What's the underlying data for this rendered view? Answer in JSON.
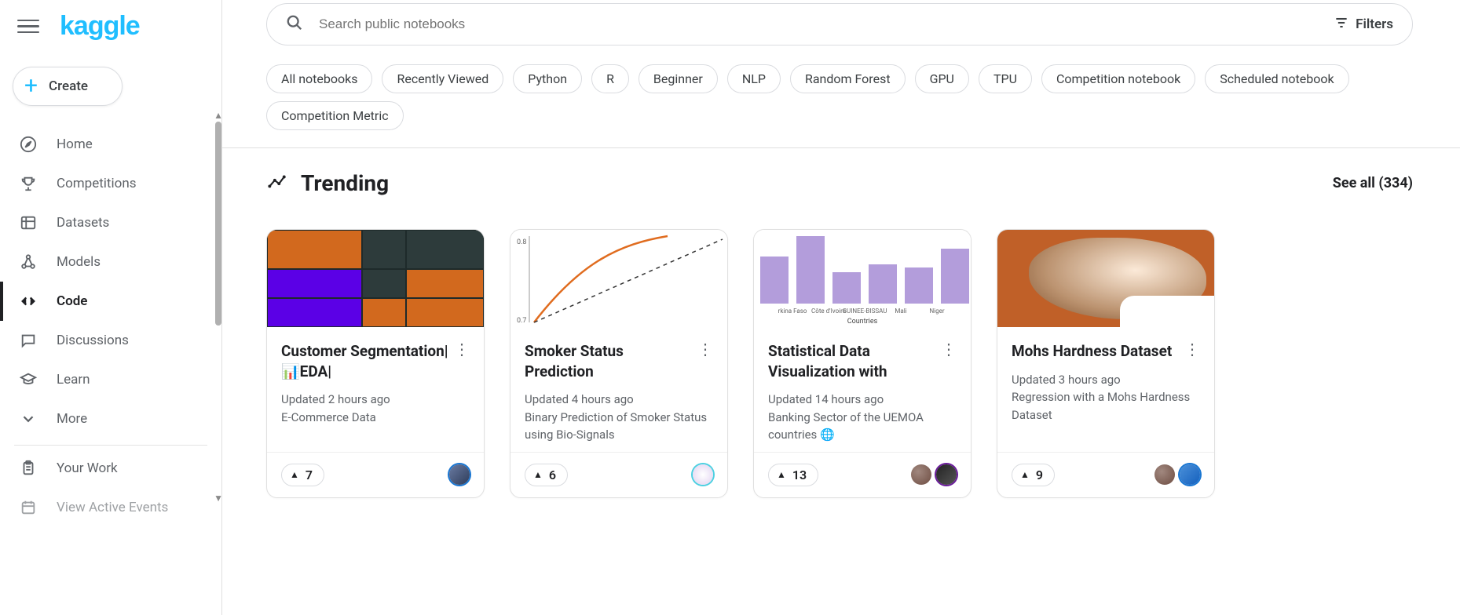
{
  "logo": "kaggle",
  "create_label": "Create",
  "nav": [
    {
      "key": "home",
      "label": "Home"
    },
    {
      "key": "competitions",
      "label": "Competitions"
    },
    {
      "key": "datasets",
      "label": "Datasets"
    },
    {
      "key": "models",
      "label": "Models"
    },
    {
      "key": "code",
      "label": "Code",
      "active": true
    },
    {
      "key": "discussions",
      "label": "Discussions"
    },
    {
      "key": "learn",
      "label": "Learn"
    },
    {
      "key": "more",
      "label": "More"
    }
  ],
  "nav_secondary": [
    {
      "key": "your-work",
      "label": "Your Work"
    },
    {
      "key": "view-active-events",
      "label": "View Active Events"
    }
  ],
  "search": {
    "placeholder": "Search public notebooks",
    "filters_label": "Filters"
  },
  "chips": [
    "All notebooks",
    "Recently Viewed",
    "Python",
    "R",
    "Beginner",
    "NLP",
    "Random Forest",
    "GPU",
    "TPU",
    "Competition notebook",
    "Scheduled notebook",
    "Competition Metric"
  ],
  "section": {
    "title": "Trending",
    "see_all": "See all (334)"
  },
  "cards": [
    {
      "title": "Customer Segmentation|📊EDA|",
      "updated": "Updated 2 hours ago",
      "subtitle": "E-Commerce Data",
      "upvotes": "7"
    },
    {
      "title": "Smoker Status Prediction",
      "updated": "Updated 4 hours ago",
      "subtitle": "Binary Prediction of Smoker Status using Bio-Signals",
      "upvotes": "6"
    },
    {
      "title": "Statistical Data Visualization with",
      "updated": "Updated 14 hours ago",
      "subtitle": "Banking Sector of the UEMOA countries 🌐",
      "upvotes": "13"
    },
    {
      "title": "Mohs Hardness Dataset",
      "updated": "Updated 3 hours ago",
      "subtitle": "Regression with a Mohs Hardness Dataset",
      "upvotes": "9"
    }
  ],
  "thumb3_bars": {
    "countries": [
      "rkina Faso",
      "Côte d'Ivoire",
      "GUINEE-BISSAU",
      "Mali",
      "Niger"
    ],
    "heights": [
      60,
      86,
      40,
      50,
      46,
      70
    ],
    "axis_label": "Countries"
  }
}
